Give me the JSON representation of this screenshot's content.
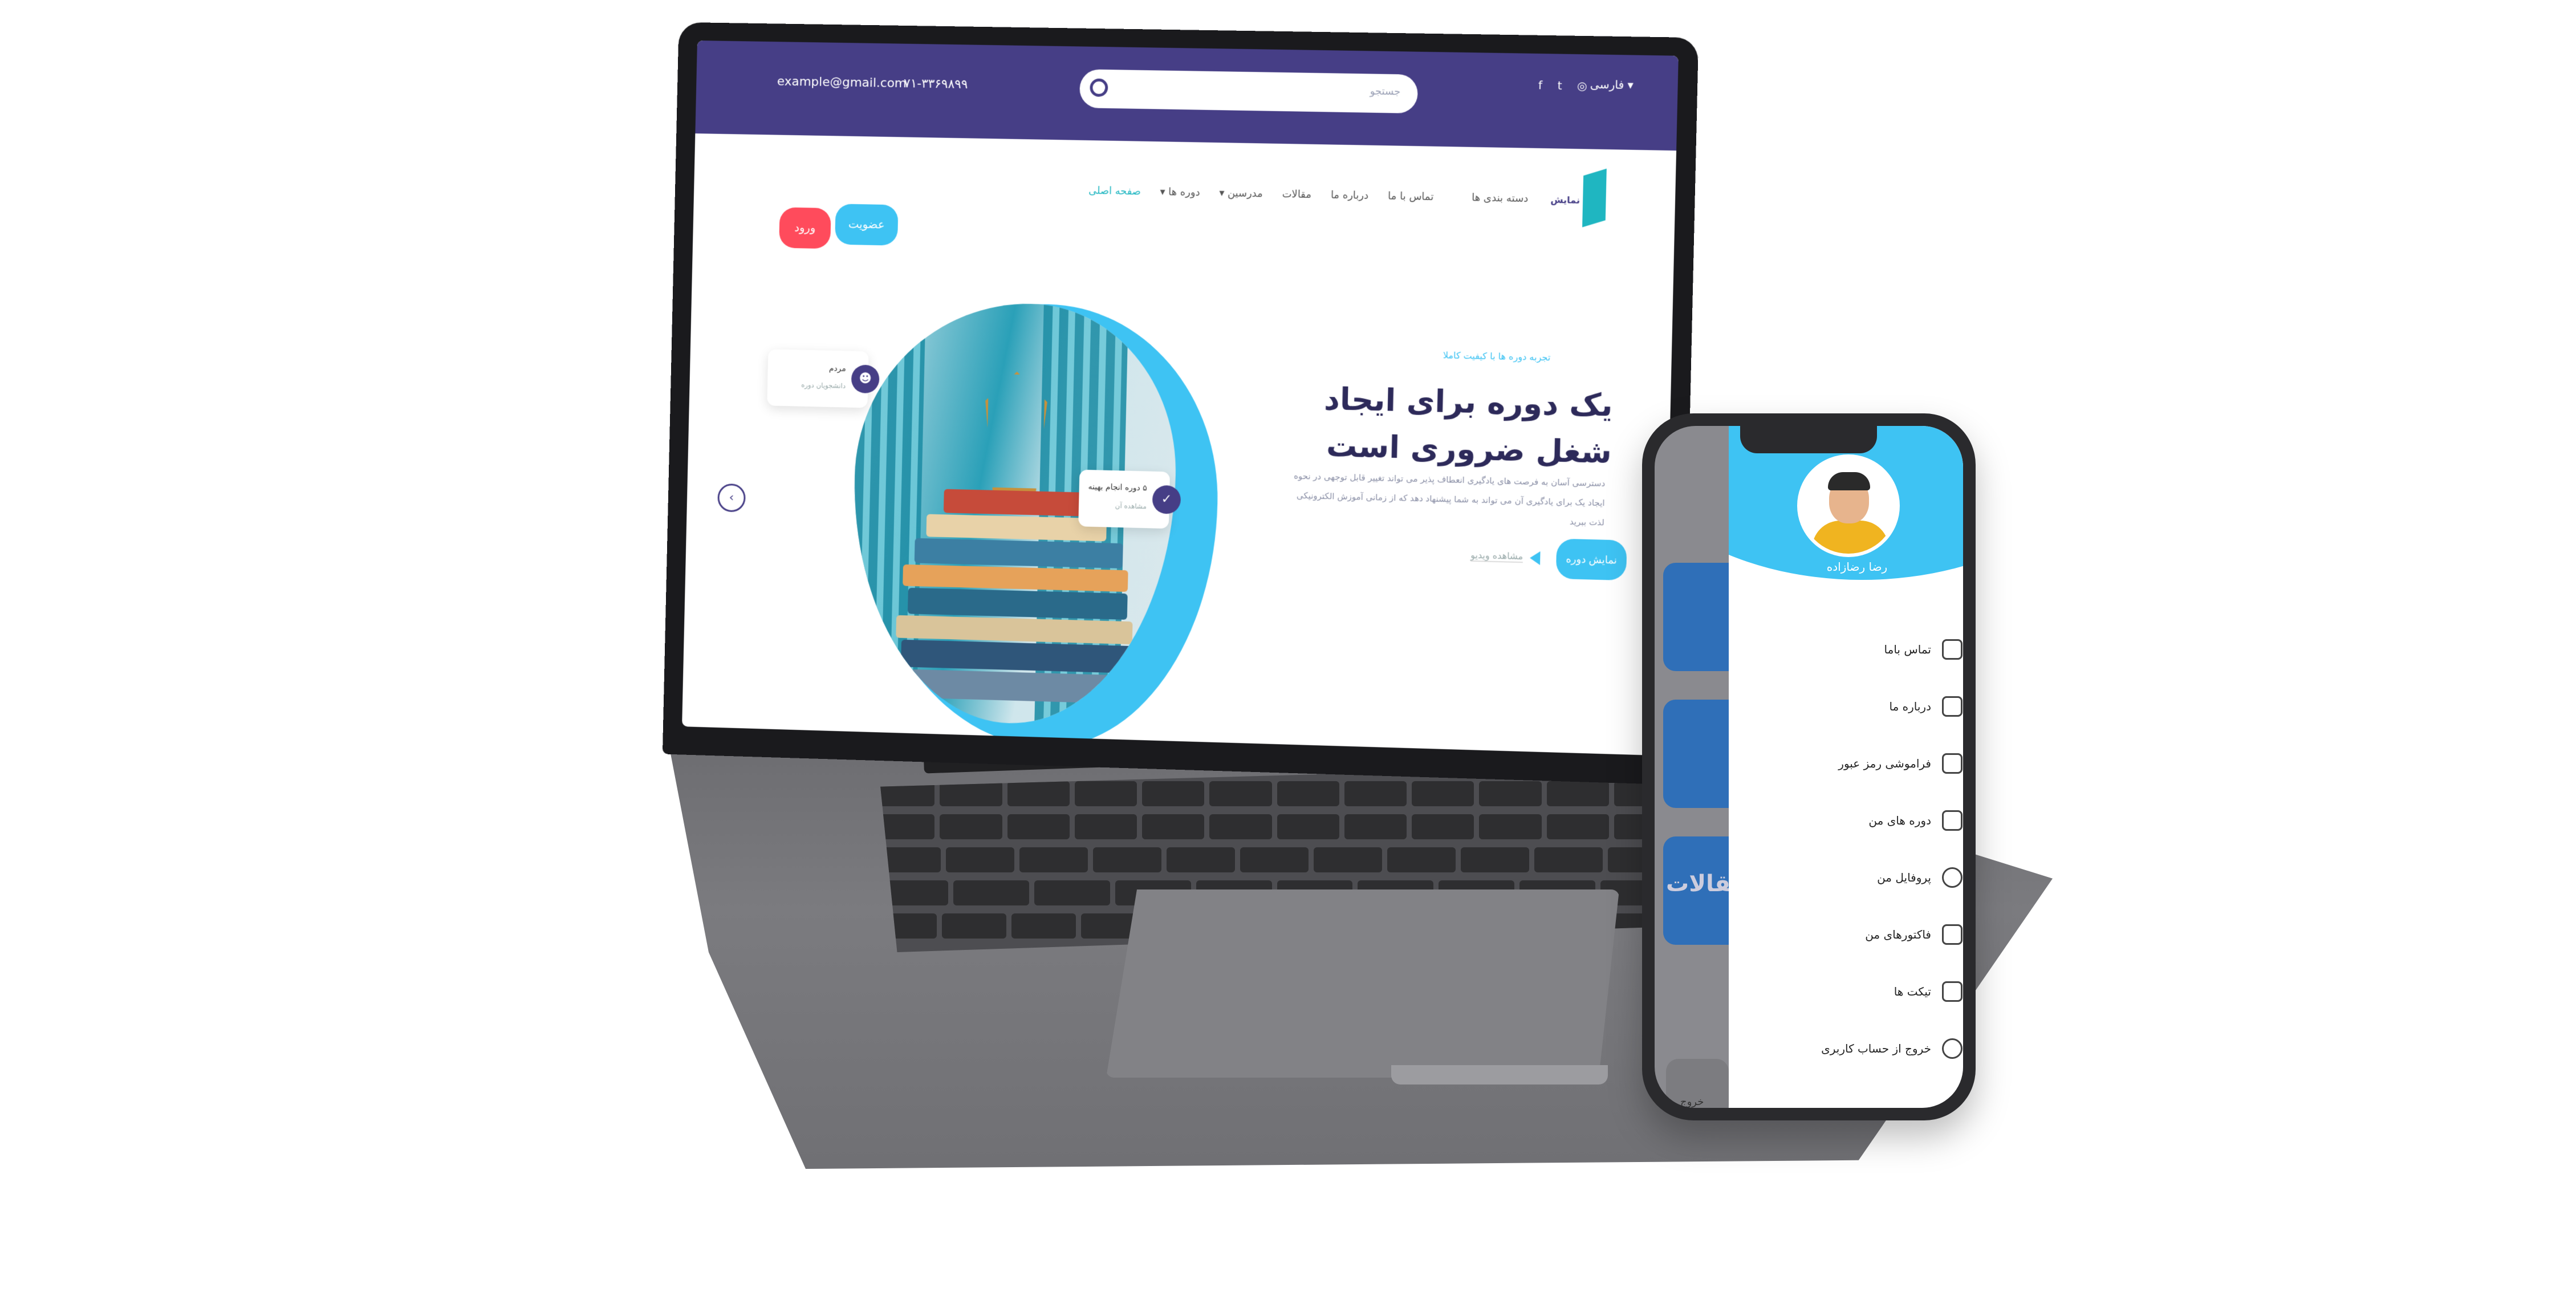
{
  "site": {
    "topbar": {
      "email": "example@gmail.com",
      "phone": "۰۷۱-۳۳۶۹۸۹۹",
      "search_placeholder": "جستجو",
      "social": "f  t  ◎",
      "language": "فارسی ▾"
    },
    "logo_text": "نمایش",
    "nav": [
      {
        "label": "صفحه اصلی",
        "active": true
      },
      {
        "label": "دوره ها ▾",
        "active": false
      },
      {
        "label": "مدرسین ▾",
        "active": false
      },
      {
        "label": "مقالات",
        "active": false
      },
      {
        "label": "درباره ما",
        "active": false
      },
      {
        "label": "تماس با ما",
        "active": false
      }
    ],
    "dash_link": "دسته بندی ها",
    "buttons": {
      "register": "عضویت",
      "login": "ورود"
    },
    "hero": {
      "kicker": "تجربه دوره ها با کیفیت کاملا",
      "title": "یک دوره برای ایجاد شغل ضروری است",
      "description": "دسترسی آسان به فرصت های یادگیری انعطاف پذیر می تواند تغییر قابل توجهی در نحوه ایجاد یک برای یادگیری آن می تواند به شما پیشنهاد دهد که از زمانی آموزش الکترونیکی لذت ببرید",
      "course_button": "نمایش دوره",
      "video_link": "مشاهده ویدیو"
    },
    "float_cards": {
      "students_title": "مردم",
      "students_sub": "دانشجویان دوره",
      "complete_title": "۵ دوره انجام بهینه",
      "complete_sub": "مشاهده آن"
    }
  },
  "phone": {
    "user_name": "رضا رضازاده",
    "background_label": "مقالات",
    "background_exit": "خروج",
    "menu": [
      {
        "label": "تماس باما",
        "icon": "phone-icon"
      },
      {
        "label": "درباره ما",
        "icon": "info-icon"
      },
      {
        "label": "فراموشی رمز عبور",
        "icon": "lock-icon"
      },
      {
        "label": "دوره های من",
        "icon": "courses-icon"
      },
      {
        "label": "پروفایل من",
        "icon": "profile-icon"
      },
      {
        "label": "فاکتورهای من",
        "icon": "invoice-icon"
      },
      {
        "label": "تیکت ها",
        "icon": "ticket-icon"
      },
      {
        "label": "خروج از حساب کاربری",
        "icon": "power-icon"
      }
    ]
  },
  "colors": {
    "brand_purple": "#463e86",
    "accent_cyan": "#3ec3f3",
    "login_red": "#ff4b5c"
  }
}
